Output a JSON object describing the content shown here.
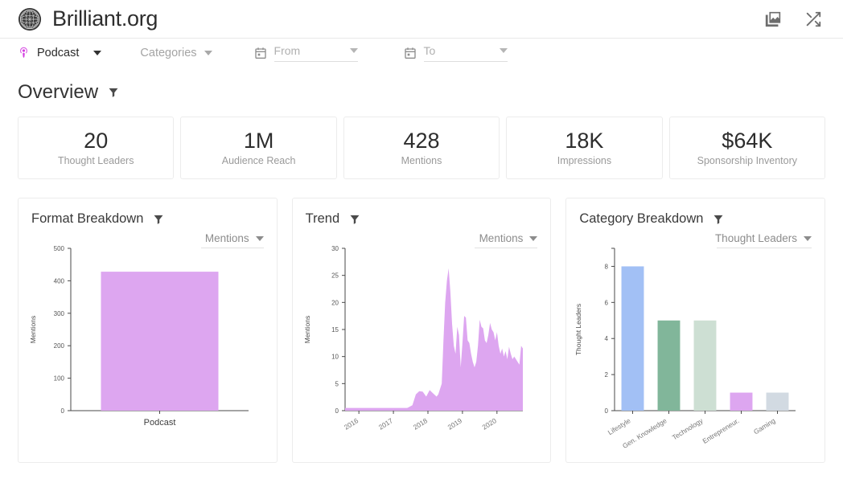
{
  "header": {
    "brand": "Brilliant.org",
    "logo_icon": "globe-sphere-icon",
    "icons": [
      {
        "name": "media-gallery-icon",
        "glyph": "image"
      },
      {
        "name": "shuffle-icon",
        "glyph": "shuffle"
      }
    ]
  },
  "filters": {
    "media_type": {
      "label": "Podcast",
      "icon": "podcast-icon",
      "color": "#d33ee0"
    },
    "categories": {
      "label": "Categories"
    },
    "date_from": {
      "placeholder": "From",
      "icon": "calendar-icon"
    },
    "date_to": {
      "placeholder": "To",
      "icon": "calendar-icon"
    }
  },
  "overview": {
    "title": "Overview",
    "filter_icon": "funnel-icon",
    "kpis": [
      {
        "value": "20",
        "label": "Thought Leaders"
      },
      {
        "value": "1M",
        "label": "Audience Reach"
      },
      {
        "value": "428",
        "label": "Mentions"
      },
      {
        "value": "18K",
        "label": "Impressions"
      },
      {
        "value": "$64K",
        "label": "Sponsorship Inventory"
      }
    ]
  },
  "panels": [
    {
      "title": "Format Breakdown",
      "filter_icon": "funnel-icon",
      "metric_label": "Mentions"
    },
    {
      "title": "Trend",
      "filter_icon": "funnel-icon",
      "metric_label": "Mentions"
    },
    {
      "title": "Category Breakdown",
      "filter_icon": "funnel-icon",
      "metric_label": "Thought Leaders"
    }
  ],
  "chart_data": [
    {
      "type": "bar",
      "title": "Format Breakdown",
      "categories": [
        "Podcast"
      ],
      "values": [
        428
      ],
      "colors": [
        "#dda6f0"
      ],
      "xlabel": "",
      "ylabel": "Mentions",
      "ylim": [
        0,
        500
      ],
      "yticks": [
        0,
        100,
        200,
        300,
        400,
        500
      ],
      "grid": false,
      "legend": false
    },
    {
      "type": "area",
      "title": "Trend",
      "xlabel": "",
      "ylabel": "Mentions",
      "ylim": [
        0,
        30
      ],
      "yticks": [
        0,
        5,
        10,
        15,
        20,
        25,
        30
      ],
      "xticks": [
        "2016",
        "2017",
        "2018",
        "2019",
        "2020"
      ],
      "color": "#dda6f0",
      "grid": false,
      "legend": false,
      "x": [
        2015.6,
        2015.8,
        2016.0,
        2016.2,
        2016.4,
        2016.6,
        2016.8,
        2017.0,
        2017.2,
        2017.4,
        2017.55,
        2017.65,
        2017.75,
        2017.85,
        2017.95,
        2018.05,
        2018.15,
        2018.25,
        2018.3,
        2018.4,
        2018.45,
        2018.5,
        2018.55,
        2018.6,
        2018.65,
        2018.7,
        2018.75,
        2018.8,
        2018.85,
        2018.9,
        2018.95,
        2019.0,
        2019.05,
        2019.1,
        2019.15,
        2019.2,
        2019.25,
        2019.3,
        2019.35,
        2019.4,
        2019.45,
        2019.5,
        2019.55,
        2019.6,
        2019.65,
        2019.7,
        2019.75,
        2019.8,
        2019.85,
        2019.9,
        2019.95,
        2020.0,
        2020.05,
        2020.1,
        2020.15,
        2020.2,
        2020.25,
        2020.3,
        2020.35,
        2020.4,
        2020.45,
        2020.5,
        2020.55,
        2020.6,
        2020.65,
        2020.7,
        2020.75
      ],
      "values": [
        0.5,
        0.5,
        0.5,
        0.5,
        0.5,
        0.5,
        0.5,
        0.5,
        0.5,
        0.5,
        1.0,
        3.0,
        3.6,
        3.5,
        2.6,
        3.8,
        3.2,
        2.6,
        3.0,
        5.0,
        13.0,
        20.0,
        24.0,
        26.3,
        22.0,
        16.0,
        12.0,
        10.5,
        15.5,
        14.0,
        8.0,
        12.5,
        17.5,
        17.2,
        13.0,
        12.5,
        10.5,
        9.0,
        8.0,
        9.0,
        12.0,
        16.8,
        15.5,
        15.2,
        13.0,
        12.5,
        14.0,
        16.2,
        15.0,
        14.5,
        13.0,
        14.5,
        12.0,
        10.5,
        11.5,
        10.0,
        11.0,
        9.5,
        11.8,
        10.5,
        9.5,
        10.0,
        9.5,
        9.0,
        8.5,
        12.0,
        11.5
      ]
    },
    {
      "type": "bar",
      "title": "Category Breakdown",
      "categories": [
        "Lifestyle",
        "Gen. Knowledge",
        "Technology",
        "Entrepreneur.",
        "Gaming"
      ],
      "values": [
        8,
        5,
        5,
        1,
        1
      ],
      "colors": [
        "#a2c0f5",
        "#81b69a",
        "#cddfd3",
        "#dda6f0",
        "#d2dae2"
      ],
      "xlabel": "",
      "ylabel": "Thought Leaders",
      "ylim": [
        0,
        9
      ],
      "yticks": [
        0,
        2,
        4,
        6,
        8
      ],
      "grid": false,
      "legend": false
    }
  ]
}
